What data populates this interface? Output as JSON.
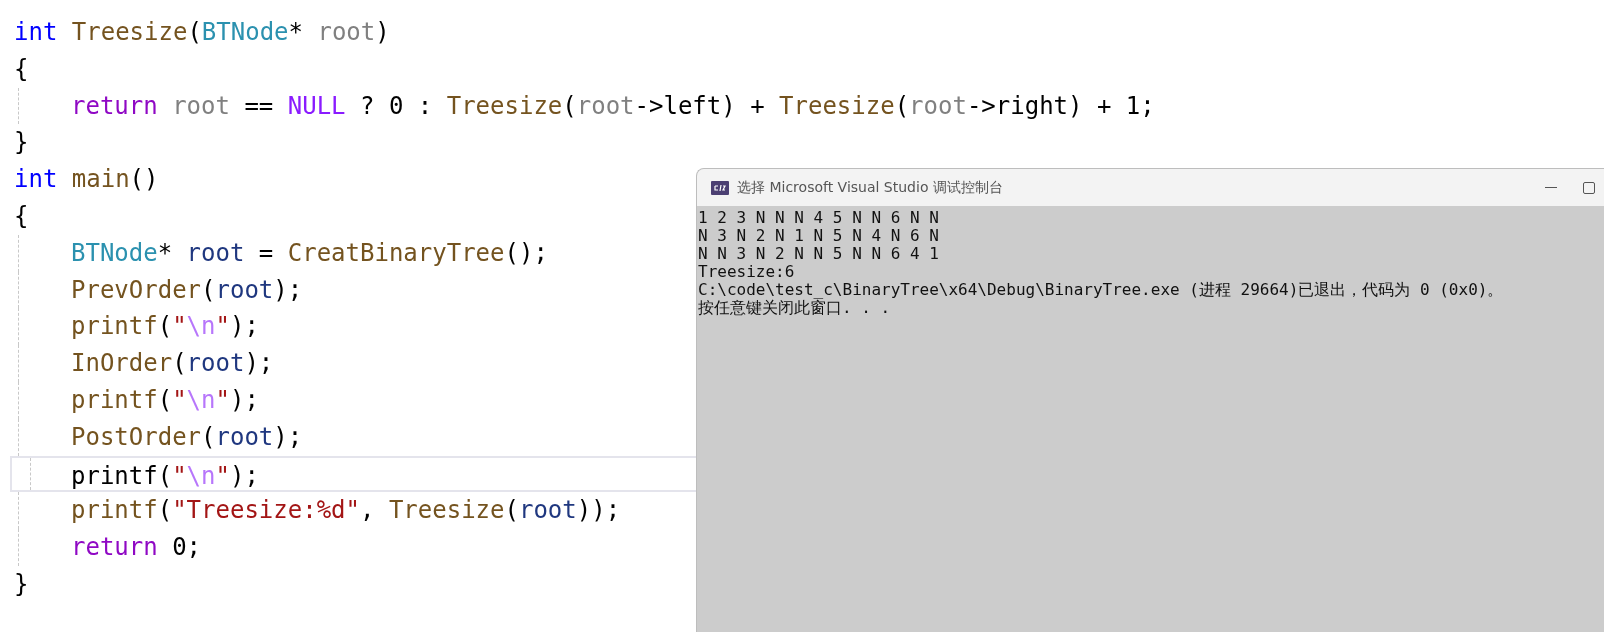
{
  "editor": {
    "lines": [
      {
        "indented": false,
        "current": false,
        "tokens": [
          {
            "text": "int ",
            "kind": "keyword"
          },
          {
            "text": "Treesize",
            "kind": "function"
          },
          {
            "text": "(",
            "kind": "plain"
          },
          {
            "text": "BTNode",
            "kind": "type"
          },
          {
            "text": "* ",
            "kind": "plain"
          },
          {
            "text": "root",
            "kind": "param"
          },
          {
            "text": ")",
            "kind": "plain"
          }
        ]
      },
      {
        "indented": false,
        "current": false,
        "tokens": [
          {
            "text": "{",
            "kind": "plain"
          }
        ]
      },
      {
        "indented": true,
        "current": false,
        "tokens": [
          {
            "text": "return ",
            "kind": "control"
          },
          {
            "text": "root",
            "kind": "param"
          },
          {
            "text": " == ",
            "kind": "plain"
          },
          {
            "text": "NULL",
            "kind": "macro"
          },
          {
            "text": " ? 0 : ",
            "kind": "plain"
          },
          {
            "text": "Treesize",
            "kind": "function"
          },
          {
            "text": "(",
            "kind": "plain"
          },
          {
            "text": "root",
            "kind": "param"
          },
          {
            "text": "->left) + ",
            "kind": "plain"
          },
          {
            "text": "Treesize",
            "kind": "function"
          },
          {
            "text": "(",
            "kind": "plain"
          },
          {
            "text": "root",
            "kind": "param"
          },
          {
            "text": "->right) + 1;",
            "kind": "plain"
          }
        ]
      },
      {
        "indented": false,
        "current": false,
        "tokens": [
          {
            "text": "}",
            "kind": "plain"
          }
        ]
      },
      {
        "indented": false,
        "current": false,
        "tokens": [
          {
            "text": "int ",
            "kind": "keyword"
          },
          {
            "text": "main",
            "kind": "function"
          },
          {
            "text": "()",
            "kind": "plain"
          }
        ]
      },
      {
        "indented": false,
        "current": false,
        "tokens": [
          {
            "text": "{",
            "kind": "plain"
          }
        ]
      },
      {
        "indented": true,
        "current": false,
        "tokens": [
          {
            "text": "BTNode",
            "kind": "type"
          },
          {
            "text": "* ",
            "kind": "plain"
          },
          {
            "text": "root",
            "kind": "local"
          },
          {
            "text": " = ",
            "kind": "plain"
          },
          {
            "text": "CreatBinaryTree",
            "kind": "function"
          },
          {
            "text": "();",
            "kind": "plain"
          }
        ]
      },
      {
        "indented": true,
        "current": false,
        "tokens": [
          {
            "text": "PrevOrder",
            "kind": "function"
          },
          {
            "text": "(",
            "kind": "plain"
          },
          {
            "text": "root",
            "kind": "local"
          },
          {
            "text": ");",
            "kind": "plain"
          }
        ]
      },
      {
        "indented": true,
        "current": false,
        "tokens": [
          {
            "text": "printf",
            "kind": "function"
          },
          {
            "text": "(",
            "kind": "plain"
          },
          {
            "text": "\"",
            "kind": "string"
          },
          {
            "text": "\\n",
            "kind": "escape"
          },
          {
            "text": "\"",
            "kind": "string"
          },
          {
            "text": ");",
            "kind": "plain"
          }
        ]
      },
      {
        "indented": true,
        "current": false,
        "tokens": [
          {
            "text": "InOrder",
            "kind": "function"
          },
          {
            "text": "(",
            "kind": "plain"
          },
          {
            "text": "root",
            "kind": "local"
          },
          {
            "text": ");",
            "kind": "plain"
          }
        ]
      },
      {
        "indented": true,
        "current": false,
        "tokens": [
          {
            "text": "printf",
            "kind": "function"
          },
          {
            "text": "(",
            "kind": "plain"
          },
          {
            "text": "\"",
            "kind": "string"
          },
          {
            "text": "\\n",
            "kind": "escape"
          },
          {
            "text": "\"",
            "kind": "string"
          },
          {
            "text": ");",
            "kind": "plain"
          }
        ]
      },
      {
        "indented": true,
        "current": false,
        "tokens": [
          {
            "text": "PostOrder",
            "kind": "function"
          },
          {
            "text": "(",
            "kind": "plain"
          },
          {
            "text": "root",
            "kind": "local"
          },
          {
            "text": ");",
            "kind": "plain"
          }
        ]
      },
      {
        "indented": true,
        "current": true,
        "tokens": [
          {
            "text": "printf",
            "kind": "plain"
          },
          {
            "text": "(",
            "kind": "plain"
          },
          {
            "text": "\"",
            "kind": "string"
          },
          {
            "text": "\\n",
            "kind": "escape"
          },
          {
            "text": "\"",
            "kind": "string"
          },
          {
            "text": ");",
            "kind": "plain"
          }
        ]
      },
      {
        "indented": true,
        "current": false,
        "tokens": [
          {
            "text": "printf",
            "kind": "function"
          },
          {
            "text": "(",
            "kind": "plain"
          },
          {
            "text": "\"Treesize:%d\"",
            "kind": "string"
          },
          {
            "text": ", ",
            "kind": "plain"
          },
          {
            "text": "Treesize",
            "kind": "function"
          },
          {
            "text": "(",
            "kind": "plain"
          },
          {
            "text": "root",
            "kind": "local"
          },
          {
            "text": "));",
            "kind": "plain"
          }
        ]
      },
      {
        "indented": true,
        "current": false,
        "tokens": [
          {
            "text": "return",
            "kind": "control"
          },
          {
            "text": " 0;",
            "kind": "plain"
          }
        ]
      },
      {
        "indented": false,
        "current": false,
        "tokens": [
          {
            "text": "}",
            "kind": "plain"
          }
        ]
      }
    ]
  },
  "console": {
    "title": "选择 Microsoft Visual Studio 调试控制台",
    "output": [
      "1 2 3 N N N 4 5 N N 6 N N",
      "N 3 N 2 N 1 N 5 N 4 N 6 N",
      "N N 3 N 2 N N 5 N N 6 4 1",
      "Treesize:6",
      "C:\\code\\test_c\\BinaryTree\\x64\\Debug\\BinaryTree.exe (进程 29664)已退出，代码为 0 (0x0)。",
      "按任意键关闭此窗口. . ."
    ]
  }
}
